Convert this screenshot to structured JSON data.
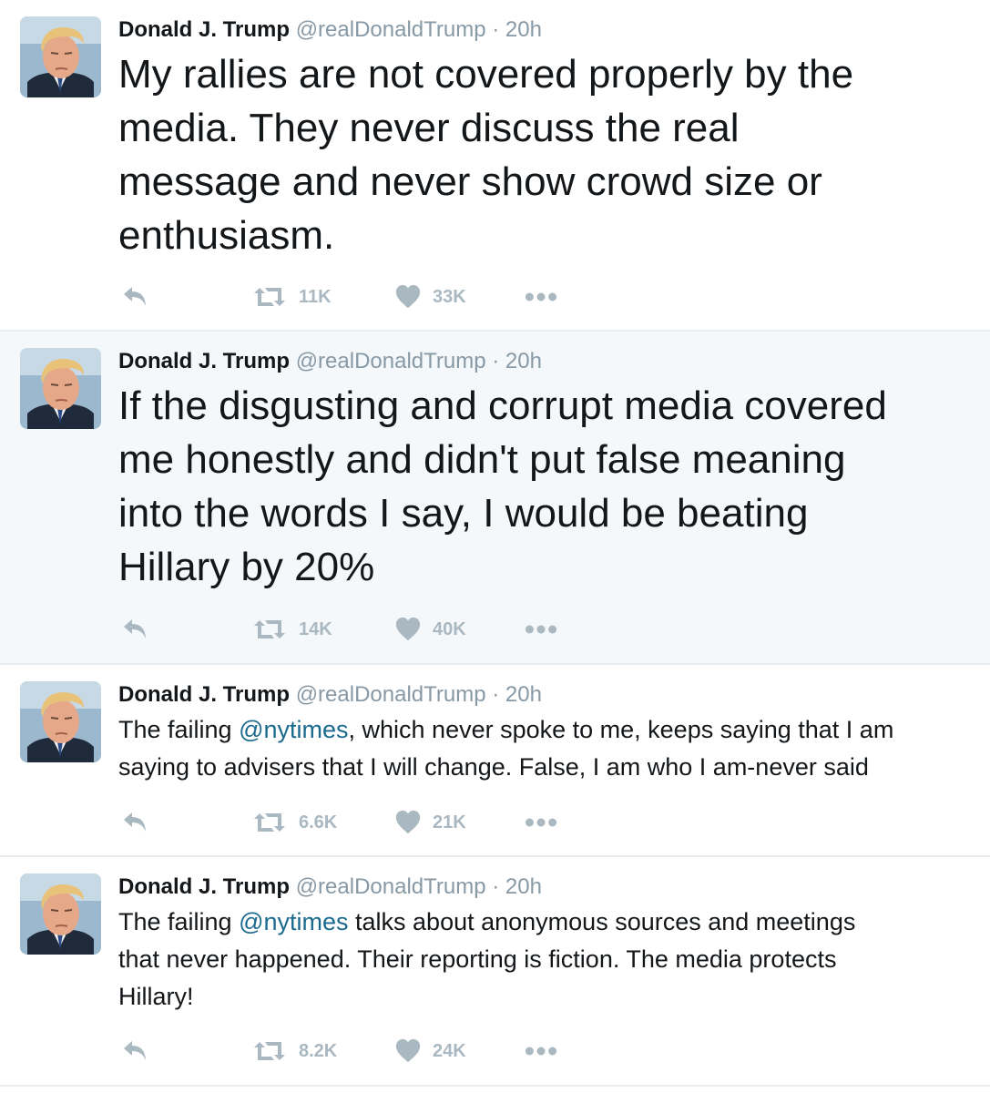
{
  "tweets": [
    {
      "author": "Donald J. Trump",
      "handle": "@realDonaldTrump",
      "separator": "·",
      "time": "20h",
      "lines": [
        "My rallies are not covered properly by the",
        "media. They never discuss the real",
        "message and never show crowd size or",
        "enthusiasm."
      ],
      "retweets": "11K",
      "likes": "33K"
    },
    {
      "author": "Donald J. Trump",
      "handle": "@realDonaldTrump",
      "separator": "·",
      "time": "20h",
      "lines": [
        "If the disgusting and corrupt media covered",
        "me honestly and didn't put false meaning",
        "into the words I say, I would be beating",
        "Hillary by 20%"
      ],
      "retweets": "14K",
      "likes": "40K"
    },
    {
      "author": "Donald J. Trump",
      "handle": "@realDonaldTrump",
      "separator": "·",
      "time": "20h",
      "line1_prefix": "The failing ",
      "mention": "@nytimes",
      "line1_suffix": ", which never spoke to me, keeps saying that I am",
      "line2": "saying to advisers that I will change. False, I am who I am-never said",
      "retweets": "6.6K",
      "likes": "21K"
    },
    {
      "author": "Donald J. Trump",
      "handle": "@realDonaldTrump",
      "separator": "·",
      "time": "20h",
      "line1_prefix": "The failing ",
      "mention": "@nytimes",
      "line1_suffix": " talks about anonymous sources and meetings",
      "line2": "that never happened. Their reporting is fiction. The media protects",
      "line3": "Hillary!",
      "retweets": "8.2K",
      "likes": "24K"
    }
  ],
  "icons": {
    "reply": "reply-icon",
    "retweet": "retweet-icon",
    "like": "heart-icon",
    "more": "more-icon"
  },
  "colors": {
    "text": "#14171a",
    "muted": "#8899a6",
    "action_icon": "#aab8c2",
    "mention": "#1b6a8d",
    "highlight_bg": "#f5f8fa",
    "divider": "#e6ecf0"
  }
}
